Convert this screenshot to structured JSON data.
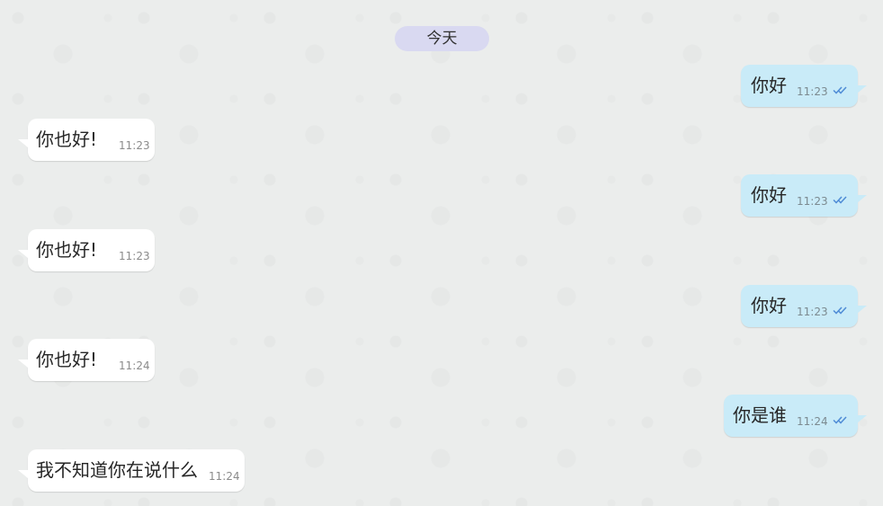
{
  "date_separator": "今天",
  "messages": [
    {
      "direction": "out",
      "text": "你好",
      "time": "11:23",
      "status_icon": "double-check-icon"
    },
    {
      "direction": "in",
      "text": "你也好!",
      "time": "11:23"
    },
    {
      "direction": "out",
      "text": "你好",
      "time": "11:23",
      "status_icon": "double-check-icon"
    },
    {
      "direction": "in",
      "text": "你也好!",
      "time": "11:23"
    },
    {
      "direction": "out",
      "text": "你好",
      "time": "11:23",
      "status_icon": "double-check-icon"
    },
    {
      "direction": "in",
      "text": "你也好!",
      "time": "11:24"
    },
    {
      "direction": "out",
      "text": "你是谁",
      "time": "11:24",
      "status_icon": "double-check-icon"
    },
    {
      "direction": "in",
      "text": "我不知道你在说什么",
      "time": "11:24"
    }
  ],
  "colors": {
    "background": "#ebedec",
    "outgoing_bubble": "#c9ebf8",
    "incoming_bubble": "#ffffff",
    "date_pill": "#d9d9f1",
    "tick": "#4f8cd6"
  }
}
